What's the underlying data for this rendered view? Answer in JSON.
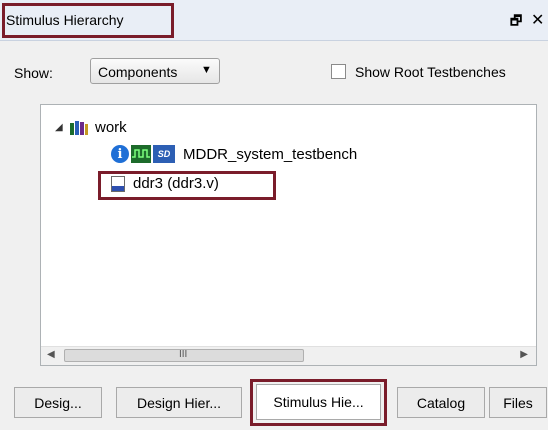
{
  "window": {
    "title": "Stimulus Hierarchy",
    "dock_glyph": "🗗",
    "close_glyph": "✕"
  },
  "toolbar": {
    "show_label": "Show:",
    "show_value": "Components",
    "show_root_testbenches_label": "Show Root Testbenches",
    "show_root_testbenches_checked": false
  },
  "tree": {
    "nodes": [
      {
        "label": "work",
        "icon": "library-books-icon",
        "expanded": true
      },
      {
        "label": "MDDR_system_testbench",
        "icons": [
          "info-icon",
          "waveform-icon",
          "smartdesign-icon"
        ]
      },
      {
        "label": "ddr3 (ddr3.v)",
        "icon": "hdl-file-icon"
      }
    ],
    "scroll_grip": "III"
  },
  "tabs": [
    {
      "label": "Desig...",
      "active": false
    },
    {
      "label": "Design Hier...",
      "active": false
    },
    {
      "label": "Stimulus Hie...",
      "active": true
    },
    {
      "label": "Catalog",
      "active": false
    },
    {
      "label": "Files",
      "active": false
    }
  ],
  "colors": {
    "highlight_border": "#7a1c2a",
    "panel_bg": "#f0f0f0",
    "titlebar_bg": "#e9eef6"
  }
}
